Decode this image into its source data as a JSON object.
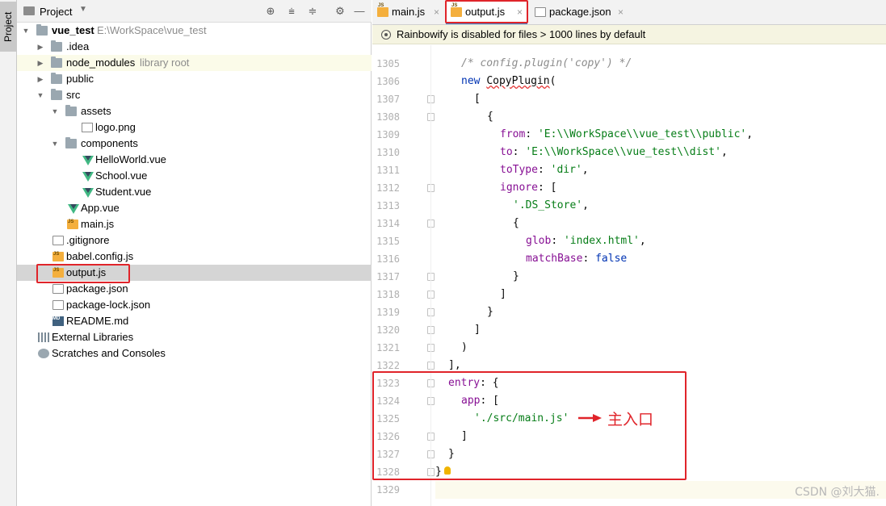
{
  "tool_strip": {
    "label": "Project"
  },
  "project_panel": {
    "title": "Project",
    "tree": [
      {
        "label": "vue_test",
        "suffix": "E:\\WorkSpace\\vue_test"
      },
      {
        "label": ".idea"
      },
      {
        "label": "node_modules",
        "suffix": "library root"
      },
      {
        "label": "public"
      },
      {
        "label": "src"
      },
      {
        "label": "assets"
      },
      {
        "label": "logo.png"
      },
      {
        "label": "components"
      },
      {
        "label": "HelloWorld.vue"
      },
      {
        "label": "School.vue"
      },
      {
        "label": "Student.vue"
      },
      {
        "label": "App.vue"
      },
      {
        "label": "main.js"
      },
      {
        "label": ".gitignore"
      },
      {
        "label": "babel.config.js"
      },
      {
        "label": "output.js"
      },
      {
        "label": "package.json"
      },
      {
        "label": "package-lock.json"
      },
      {
        "label": "README.md"
      },
      {
        "label": "External Libraries"
      },
      {
        "label": "Scratches and Consoles"
      }
    ]
  },
  "tabs": [
    {
      "label": "main.js",
      "close": "×"
    },
    {
      "label": "output.js",
      "close": "×"
    },
    {
      "label": "package.json",
      "close": "×"
    }
  ],
  "banner": {
    "text": "Rainbowify is disabled for files > 1000 lines by default"
  },
  "line_numbers": [
    "1305",
    "1306",
    "1307",
    "1308",
    "1309",
    "1310",
    "1311",
    "1312",
    "1313",
    "1314",
    "1315",
    "1316",
    "1317",
    "1318",
    "1319",
    "1320",
    "1321",
    "1322",
    "1323",
    "1324",
    "1325",
    "1326",
    "1327",
    "1328",
    "1329"
  ],
  "code": {
    "l1305": "/* config.plugin('copy') */",
    "l1306_kw": "new",
    "l1306_id": "CopyPlugin",
    "l1306_p": "(",
    "l1307": "[",
    "l1308": "{",
    "l1309_k": "from",
    "l1309_v": "'E:\\\\WorkSpace\\\\vue_test\\\\public'",
    "l1310_k": "to",
    "l1310_v": "'E:\\\\WorkSpace\\\\vue_test\\\\dist'",
    "l1311_k": "toType",
    "l1311_v": "'dir'",
    "l1312_k": "ignore",
    "l1312_p": ": [",
    "l1313_v": "'.DS_Store'",
    "l1314": "{",
    "l1315_k": "glob",
    "l1315_v": "'index.html'",
    "l1316_k": "matchBase",
    "l1316_v": "false",
    "l1317": "}",
    "l1318": "]",
    "l1319": "}",
    "l1320": "]",
    "l1321": ")",
    "l1322": "],",
    "l1323_k": "entry",
    "l1323_p": ": {",
    "l1324_k": "app",
    "l1324_p": ": [",
    "l1325_v": "'./src/main.js'",
    "l1326": "]",
    "l1327": "}",
    "l1328": "}"
  },
  "annotation": {
    "text": "主入口"
  },
  "watermark": "CSDN @刘大猫."
}
